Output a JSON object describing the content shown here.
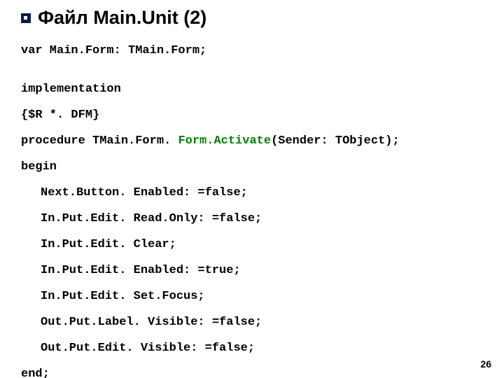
{
  "title": "Файл Main.Unit (2)",
  "code": {
    "l1": "var Main.Form: TMain.Form;",
    "l2": "implementation",
    "l3": "{$R *. DFM}",
    "l4a": "procedure TMain.Form. ",
    "l4b": "Form.Activate",
    "l4c": "(Sender: TObject);",
    "l5": "begin",
    "l6": "Next.Button. Enabled: =false;",
    "l7": "In.Put.Edit. Read.Only: =false;",
    "l8": "In.Put.Edit. Clear;",
    "l9": "In.Put.Edit. Enabled: =true;",
    "l10": "In.Put.Edit. Set.Focus;",
    "l11": "Out.Put.Label. Visible: =false;",
    "l12": "Out.Put.Edit. Visible: =false;",
    "l13": "end;"
  },
  "page_number": "26"
}
